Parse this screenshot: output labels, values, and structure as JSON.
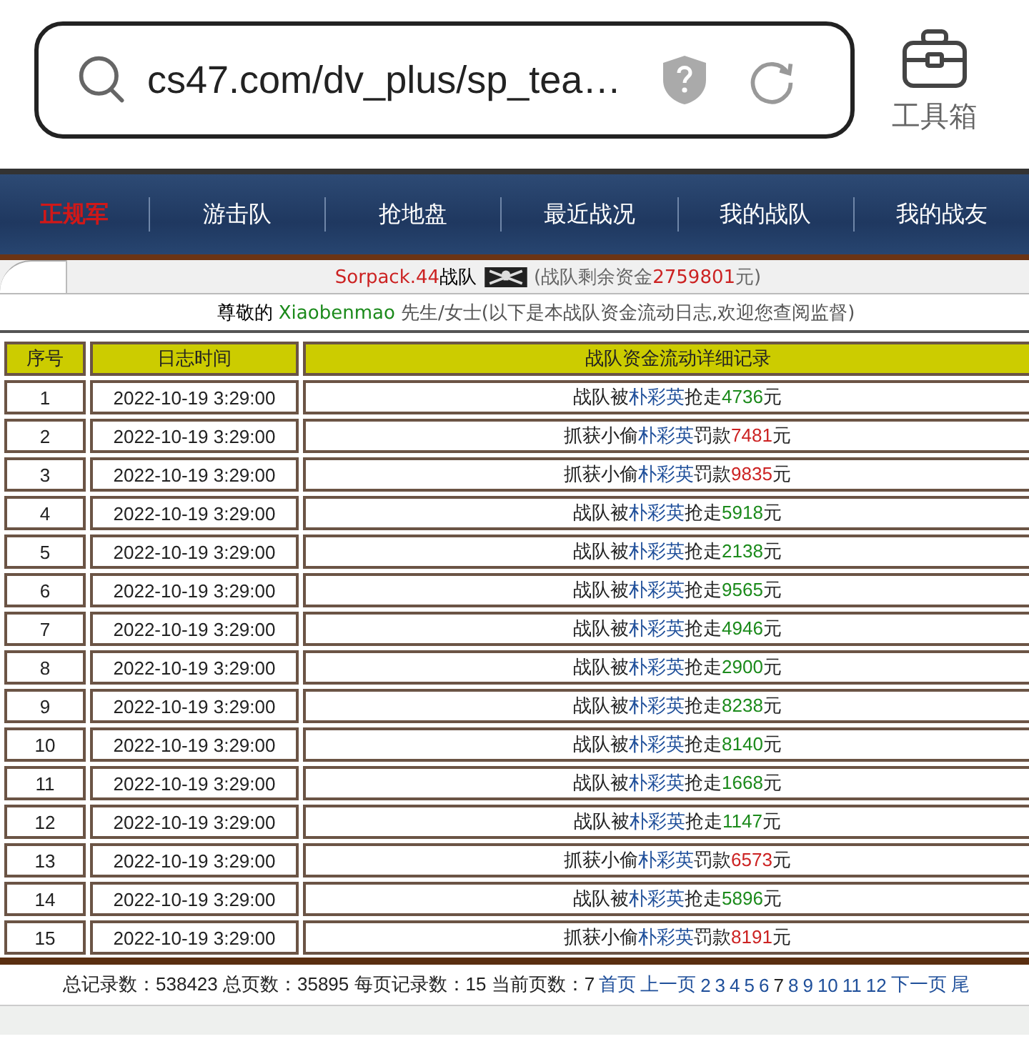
{
  "browser": {
    "url": "cs47.com/dv_plus/sp_tea…",
    "toolbox_label": "工具箱"
  },
  "nav": [
    {
      "label": "正规军",
      "selected": true
    },
    {
      "label": "游击队",
      "selected": false
    },
    {
      "label": "抢地盘",
      "selected": false
    },
    {
      "label": "最近战况",
      "selected": false
    },
    {
      "label": "我的战队",
      "selected": false
    },
    {
      "label": "我的战友",
      "selected": false
    }
  ],
  "team": {
    "name": "Sorpack.44",
    "suffix": "战队",
    "funds_pre": "(战队剩余资金",
    "funds": "2759801",
    "funds_post": "元)"
  },
  "greeting": {
    "pre": "尊敬的 ",
    "user": "Xiaobenmao",
    "post": " 先生/女士(以下是本战队资金流动日志,欢迎您查阅监督)"
  },
  "table": {
    "columns": [
      "序号",
      "日志时间",
      "战队资金流动详细记录"
    ],
    "rows": [
      {
        "no": "1",
        "time": "2022-10-19 3:29:00",
        "kind": "robbed",
        "pre": "战队被",
        "name": "朴彩英",
        "verb": "抢走",
        "amount": "4736",
        "unit": "元"
      },
      {
        "no": "2",
        "time": "2022-10-19 3:29:00",
        "kind": "fine",
        "pre": "抓获小偷",
        "name": "朴彩英",
        "verb": "罚款",
        "amount": "7481",
        "unit": "元"
      },
      {
        "no": "3",
        "time": "2022-10-19 3:29:00",
        "kind": "fine",
        "pre": "抓获小偷",
        "name": "朴彩英",
        "verb": "罚款",
        "amount": "9835",
        "unit": "元"
      },
      {
        "no": "4",
        "time": "2022-10-19 3:29:00",
        "kind": "robbed",
        "pre": "战队被",
        "name": "朴彩英",
        "verb": "抢走",
        "amount": "5918",
        "unit": "元"
      },
      {
        "no": "5",
        "time": "2022-10-19 3:29:00",
        "kind": "robbed",
        "pre": "战队被",
        "name": "朴彩英",
        "verb": "抢走",
        "amount": "2138",
        "unit": "元"
      },
      {
        "no": "6",
        "time": "2022-10-19 3:29:00",
        "kind": "robbed",
        "pre": "战队被",
        "name": "朴彩英",
        "verb": "抢走",
        "amount": "9565",
        "unit": "元"
      },
      {
        "no": "7",
        "time": "2022-10-19 3:29:00",
        "kind": "robbed",
        "pre": "战队被",
        "name": "朴彩英",
        "verb": "抢走",
        "amount": "4946",
        "unit": "元"
      },
      {
        "no": "8",
        "time": "2022-10-19 3:29:00",
        "kind": "robbed",
        "pre": "战队被",
        "name": "朴彩英",
        "verb": "抢走",
        "amount": "2900",
        "unit": "元"
      },
      {
        "no": "9",
        "time": "2022-10-19 3:29:00",
        "kind": "robbed",
        "pre": "战队被",
        "name": "朴彩英",
        "verb": "抢走",
        "amount": "8238",
        "unit": "元"
      },
      {
        "no": "10",
        "time": "2022-10-19 3:29:00",
        "kind": "robbed",
        "pre": "战队被",
        "name": "朴彩英",
        "verb": "抢走",
        "amount": "8140",
        "unit": "元"
      },
      {
        "no": "11",
        "time": "2022-10-19 3:29:00",
        "kind": "robbed",
        "pre": "战队被",
        "name": "朴彩英",
        "verb": "抢走",
        "amount": "1668",
        "unit": "元"
      },
      {
        "no": "12",
        "time": "2022-10-19 3:29:00",
        "kind": "robbed",
        "pre": "战队被",
        "name": "朴彩英",
        "verb": "抢走",
        "amount": "1147",
        "unit": "元"
      },
      {
        "no": "13",
        "time": "2022-10-19 3:29:00",
        "kind": "fine",
        "pre": "抓获小偷",
        "name": "朴彩英",
        "verb": "罚款",
        "amount": "6573",
        "unit": "元"
      },
      {
        "no": "14",
        "time": "2022-10-19 3:29:00",
        "kind": "robbed",
        "pre": "战队被",
        "name": "朴彩英",
        "verb": "抢走",
        "amount": "5896",
        "unit": "元"
      },
      {
        "no": "15",
        "time": "2022-10-19 3:29:00",
        "kind": "fine",
        "pre": "抓获小偷",
        "name": "朴彩英",
        "verb": "罚款",
        "amount": "8191",
        "unit": "元"
      }
    ]
  },
  "footer": {
    "summary": "总记录数：538423 总页数：35895 每页记录数：15 当前页数：7",
    "links": [
      {
        "label": "首页",
        "selected": false
      },
      {
        "label": "上一页",
        "selected": false
      },
      {
        "label": "2",
        "selected": false
      },
      {
        "label": "3",
        "selected": false
      },
      {
        "label": "4",
        "selected": false
      },
      {
        "label": "5",
        "selected": false
      },
      {
        "label": "6",
        "selected": false
      },
      {
        "label": "7",
        "selected": true
      },
      {
        "label": "8",
        "selected": false
      },
      {
        "label": "9",
        "selected": false
      },
      {
        "label": "10",
        "selected": false
      },
      {
        "label": "11",
        "selected": false
      },
      {
        "label": "12",
        "selected": false
      },
      {
        "label": "下一页",
        "selected": false
      },
      {
        "label": "尾",
        "selected": false
      }
    ]
  }
}
